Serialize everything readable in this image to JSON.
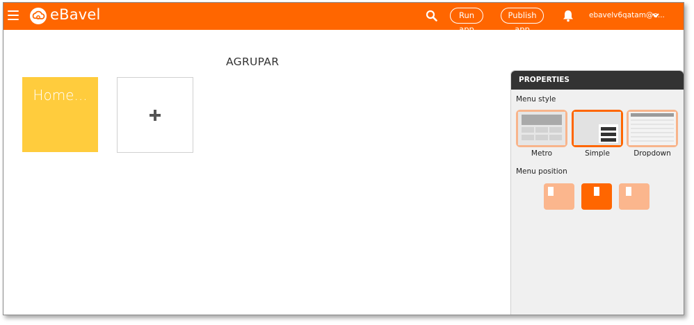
{
  "header": {
    "app_name": "eBavel",
    "run_label": "Run app",
    "publish_label": "Publish app",
    "user_email": "ebavelv6qatam@e...",
    "brand_color": "#ff6600"
  },
  "main": {
    "title": "AGRUPAR",
    "tiles": [
      {
        "label": "Home...",
        "color": "#ffcc3d"
      }
    ],
    "add_icon": "plus-icon"
  },
  "properties": {
    "title": "PROPERTIES",
    "menu_style_label": "Menu style",
    "styles": [
      {
        "label": "Metro",
        "selected": false
      },
      {
        "label": "Simple",
        "selected": true
      },
      {
        "label": "Dropdown",
        "selected": false
      }
    ],
    "menu_position_label": "Menu position",
    "positions": [
      {
        "name": "left",
        "selected": false
      },
      {
        "name": "center",
        "selected": true
      },
      {
        "name": "right",
        "selected": false
      }
    ]
  }
}
